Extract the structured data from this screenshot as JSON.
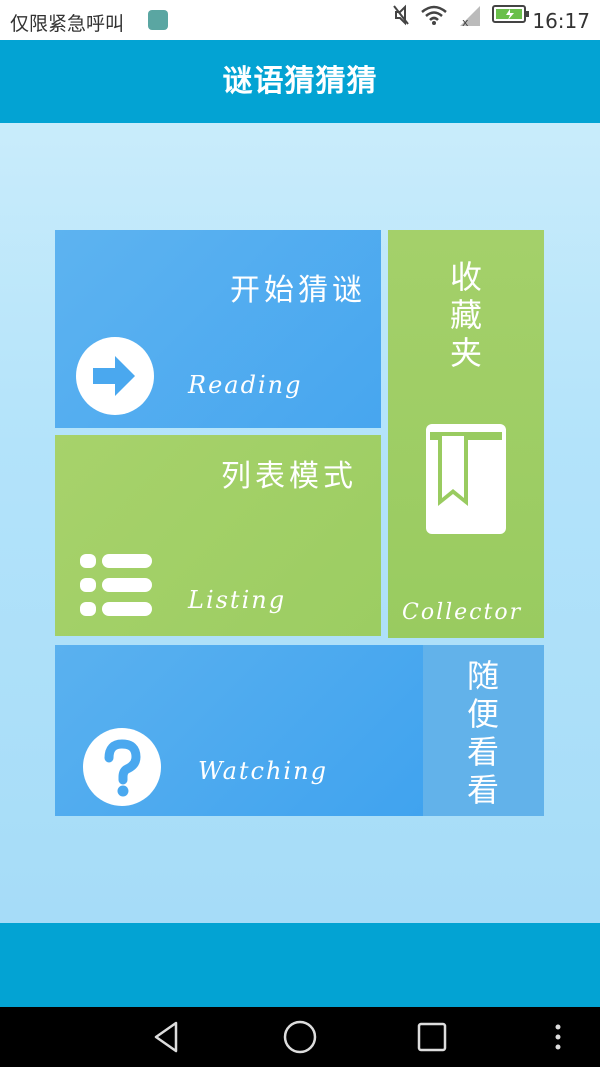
{
  "status_bar": {
    "carrier_text": "仅限紧急呼叫",
    "time": "16:17"
  },
  "header": {
    "title": "谜语猜猜猜"
  },
  "tiles": {
    "reading": {
      "label": "开始猜谜",
      "sub": "Reading",
      "icon": "play-arrow-icon"
    },
    "listing": {
      "label": "列表模式",
      "sub": "Listing",
      "icon": "list-icon"
    },
    "collector": {
      "label_chars": [
        "收",
        "藏",
        "夹"
      ],
      "sub": "Collector",
      "icon": "bookmark-book-icon"
    },
    "watching": {
      "sub": "Watching",
      "icon": "question-mark-icon"
    },
    "random": {
      "label_chars": [
        "随",
        "便",
        "看",
        "看"
      ]
    }
  },
  "colors": {
    "header": "#03a3d3",
    "tile_blue": "#4aa8ef",
    "tile_green": "#9ecf64"
  }
}
